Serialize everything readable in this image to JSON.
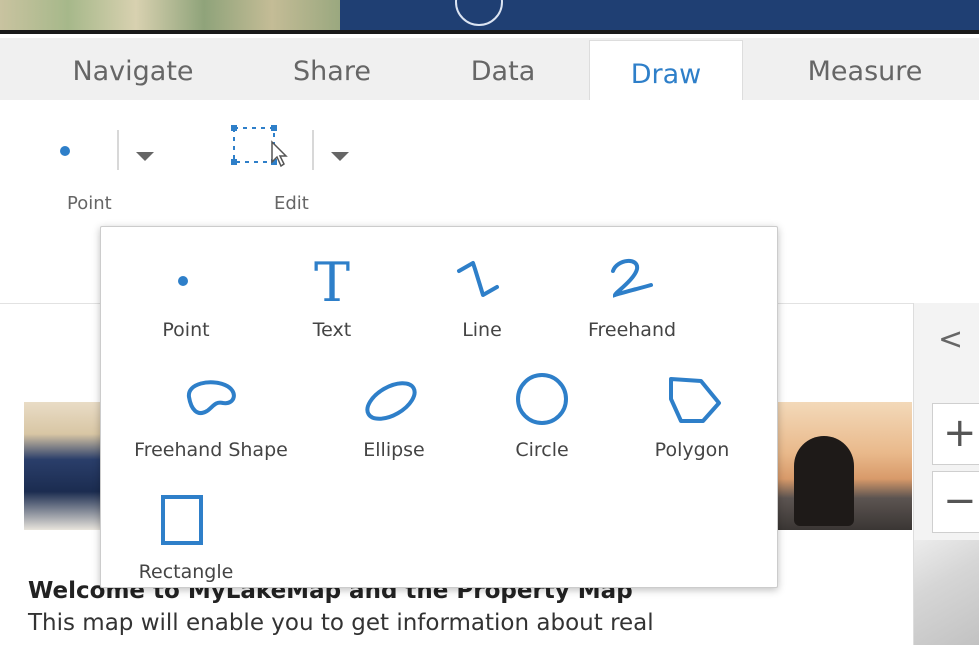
{
  "tabs": [
    {
      "label": "Navigate"
    },
    {
      "label": "Share"
    },
    {
      "label": "Data"
    },
    {
      "label": "Draw",
      "active": true
    },
    {
      "label": "Measure"
    }
  ],
  "toolbar": {
    "point_label": "Point",
    "edit_label": "Edit"
  },
  "draw_menu": {
    "items": [
      {
        "label": "Point",
        "icon": "point-icon"
      },
      {
        "label": "Text",
        "icon": "text-icon"
      },
      {
        "label": "Line",
        "icon": "line-icon"
      },
      {
        "label": "Freehand",
        "icon": "freehand-icon"
      },
      {
        "label": "Freehand Shape",
        "icon": "freehand-shape-icon"
      },
      {
        "label": "Ellipse",
        "icon": "ellipse-icon"
      },
      {
        "label": "Circle",
        "icon": "circle-icon"
      },
      {
        "label": "Polygon",
        "icon": "polygon-icon"
      },
      {
        "label": "Rectangle",
        "icon": "rectangle-icon"
      }
    ]
  },
  "map_controls": {
    "back_glyph": "<",
    "zoom_in": "+",
    "zoom_out": "−"
  },
  "welcome": {
    "title": "Welcome to MyLakeMap and the Property Map",
    "text": "This map will enable you to get information about real"
  },
  "colors": {
    "accent": "#2e7fc9",
    "tab_bg": "#f0f0f0",
    "banner": "#1f3f73"
  }
}
